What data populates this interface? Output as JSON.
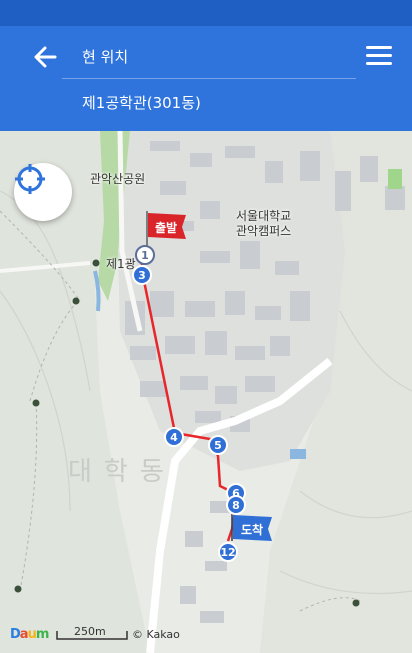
{
  "header": {
    "origin": "현 위치",
    "destination": "제1공학관(301동)"
  },
  "map": {
    "labels": {
      "park": "관악산공원",
      "campus_line1": "서울대학교",
      "campus_line2": "관악캠퍼스",
      "stop": "제1광",
      "area": "대학동"
    },
    "start_flag": "출발",
    "end_flag": "도착",
    "route_nodes": [
      "1",
      "3",
      "4",
      "5",
      "6",
      "8",
      "12"
    ],
    "scale": "250m",
    "copyright": "© Kakao",
    "logo": "Daum"
  },
  "colors": {
    "header": "#2e74dc",
    "statusbar": "#1f5fc4",
    "route": "#e8262b",
    "node": "#2f6fd6",
    "start_flag": "#d9252a",
    "end_flag": "#2f6fd6"
  }
}
